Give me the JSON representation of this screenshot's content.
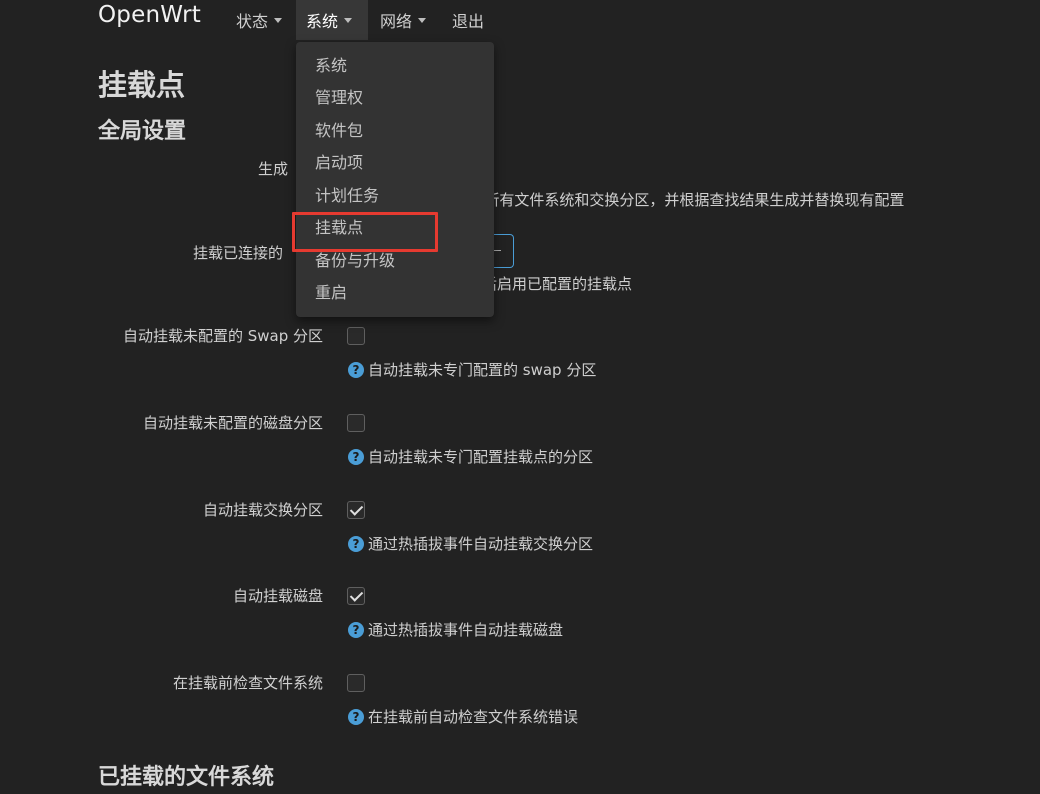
{
  "navbar": {
    "brand": "OpenWrt",
    "items": [
      {
        "label": "状态"
      },
      {
        "label": "系统"
      },
      {
        "label": "网络"
      },
      {
        "label": "退出"
      }
    ]
  },
  "dropdown": {
    "items": [
      {
        "label": "系统"
      },
      {
        "label": "管理权"
      },
      {
        "label": "软件包"
      },
      {
        "label": "启动项"
      },
      {
        "label": "计划任务"
      },
      {
        "label": "挂载点"
      },
      {
        "label": "备份与升级"
      },
      {
        "label": "重启"
      }
    ]
  },
  "page": {
    "title": "挂载点",
    "section_global": "全局设置",
    "section_mounted": "已挂载的文件系统"
  },
  "partial": {
    "generate_label": "生成",
    "generate_help_tail": "J所有文件系统和交换分区，并根据查找结果生成并替换现有配置",
    "mount_attached_label": "挂载已连接的",
    "mount_attached_help_tail": "后启用已配置的挂载点"
  },
  "form": {
    "rows": [
      {
        "label": "自动挂载未配置的 Swap 分区",
        "checked": false,
        "help": "自动挂载未专门配置的 swap 分区"
      },
      {
        "label": "自动挂载未配置的磁盘分区",
        "checked": false,
        "help": "自动挂载未专门配置挂载点的分区"
      },
      {
        "label": "自动挂载交换分区",
        "checked": true,
        "help": "通过热插拔事件自动挂载交换分区"
      },
      {
        "label": "自动挂载磁盘",
        "checked": true,
        "help": "通过热插拔事件自动挂载磁盘"
      },
      {
        "label": "在挂载前检查文件系统",
        "checked": false,
        "help": "在挂载前自动检查文件系统错误"
      }
    ]
  },
  "colors": {
    "background": "#222222",
    "accent": "#4a9dd6",
    "highlight": "#e63a30"
  }
}
